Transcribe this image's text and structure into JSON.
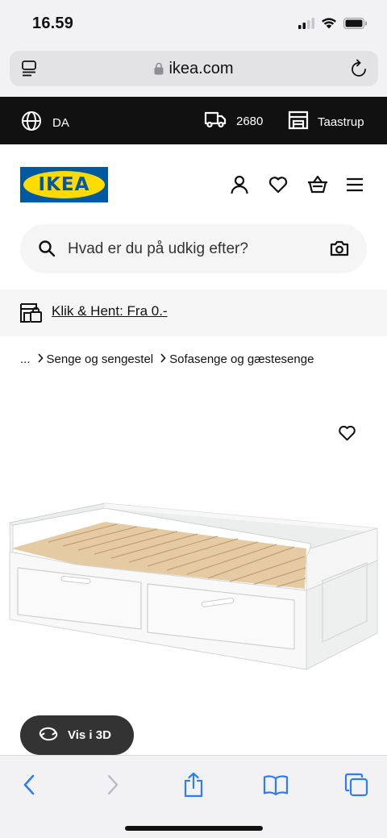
{
  "status_bar": {
    "time": "16.59"
  },
  "browser": {
    "url": "ikea.com"
  },
  "top_strip": {
    "language": "DA",
    "postal_code": "2680",
    "store": "Taastrup"
  },
  "header": {
    "logo_text": "IKEA"
  },
  "search": {
    "placeholder": "Hvad er du på udkig efter?"
  },
  "click_collect": {
    "label": "Klik & Hent: Fra 0.-"
  },
  "breadcrumb": {
    "ellipsis": "...",
    "items": [
      "Senge og sengestel",
      "Sofasenge og gæstesenge"
    ]
  },
  "product": {
    "view_3d_label": "Vis i 3D"
  },
  "colors": {
    "black_strip": "#111111",
    "ikea_blue": "#0058a3",
    "ikea_yellow": "#ffdb00",
    "safari_blue": "#2f7cf6"
  },
  "icons": [
    "globe-icon",
    "truck-icon",
    "store-icon",
    "user-icon",
    "heart-icon",
    "basket-icon",
    "menu-icon",
    "search-icon",
    "camera-icon",
    "click-collect-icon",
    "rotate-3d-icon",
    "back-icon",
    "forward-icon",
    "share-icon",
    "bookmarks-icon",
    "tabs-icon"
  ]
}
